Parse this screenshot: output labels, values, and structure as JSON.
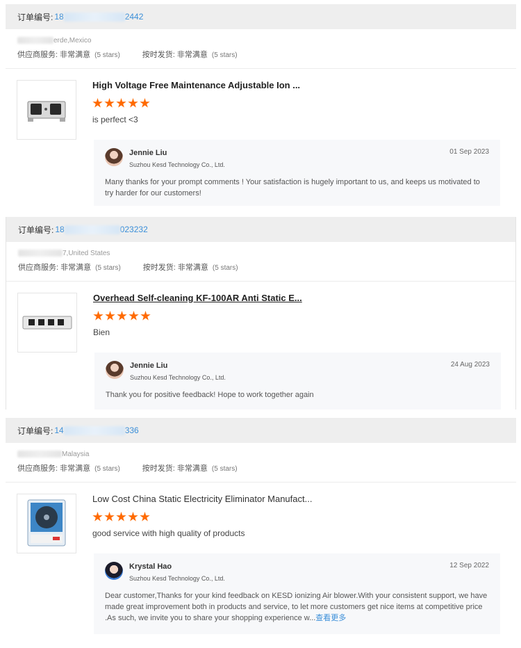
{
  "orders": [
    {
      "order_label": "订单编号:",
      "order_id_prefix": "18",
      "order_id_suffix": "2442",
      "location": "erde,Mexico",
      "supplier_service_label": "供应商服务:",
      "supplier_service_value": "非常满意",
      "supplier_service_stars": "(5 stars)",
      "shipping_label": "按时发货:",
      "shipping_value": "非常满意",
      "shipping_stars": "(5 stars)",
      "product_title": "High Voltage Free Maintenance Adjustable Ion ...",
      "rating": 5,
      "review": "is perfect <3",
      "reply": {
        "name": "Jennie Liu",
        "company": "Suzhou Kesd Technology Co., Ltd.",
        "date": "01 Sep 2023",
        "text": "Many thanks for your prompt comments ! Your satisfaction is hugely important to us, and keeps us motivated to try harder for our customers!"
      }
    },
    {
      "order_label": "订单编号:",
      "order_id_prefix": "18",
      "order_id_suffix": "023232",
      "location": "7,United States",
      "supplier_service_label": "供应商服务:",
      "supplier_service_value": "非常满意",
      "supplier_service_stars": "(5 stars)",
      "shipping_label": "按时发货:",
      "shipping_value": "非常满意",
      "shipping_stars": "(5 stars)",
      "product_title": "Overhead Self-cleaning KF-100AR Anti Static E...",
      "rating": 5,
      "review": "Bien",
      "reply": {
        "name": "Jennie Liu",
        "company": "Suzhou Kesd Technology Co., Ltd.",
        "date": "24 Aug 2023",
        "text": "Thank you for positive feedback! Hope to work together again"
      }
    },
    {
      "order_label": "订单编号:",
      "order_id_prefix": "14",
      "order_id_suffix": "336",
      "location": "Malaysia",
      "supplier_service_label": "供应商服务:",
      "supplier_service_value": "非常满意",
      "supplier_service_stars": "(5 stars)",
      "shipping_label": "按时发货:",
      "shipping_value": "非常满意",
      "shipping_stars": "(5 stars)",
      "product_title": "Low Cost China Static Electricity Eliminator Manufact...",
      "rating": 5,
      "review": "good service with high quality of products",
      "reply": {
        "name": "Krystal Hao",
        "company": "Suzhou Kesd Technology Co., Ltd.",
        "date": "12 Sep 2022",
        "text": "Dear customer,Thanks for your kind feedback on KESD ionizing Air blower.With your consistent support, we have made great improvement both in products and service, to let more customers get nice items at competitive price .As such, we invite you to share your shopping experience w...",
        "more_label": "查看更多"
      }
    }
  ],
  "colors": {
    "accent": "#3b8fd9",
    "star": "#ff6a00",
    "header_bg": "#eeeeee",
    "reply_bg": "#f7f8fa"
  }
}
